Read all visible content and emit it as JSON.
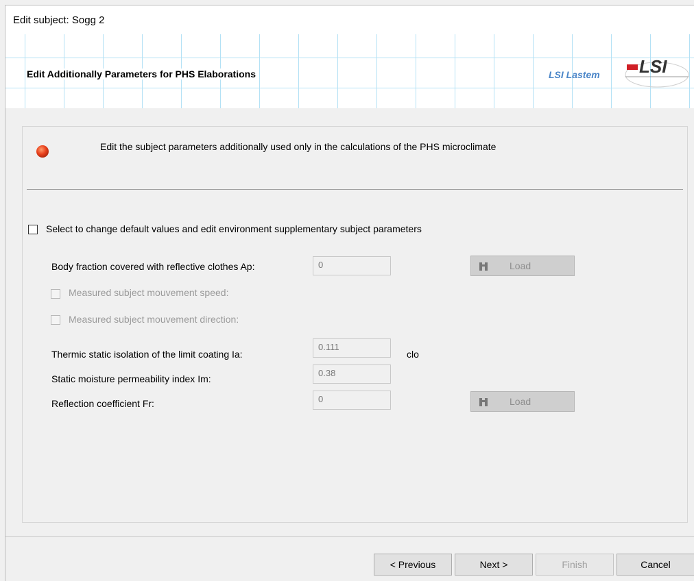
{
  "window": {
    "title": "Edit subject: Sogg 2"
  },
  "header": {
    "title": "Edit Additionally Parameters for PHS Elaborations",
    "brand_text": "LSI Lastem",
    "logo_text": "LSI"
  },
  "info": {
    "text": "Edit the subject parameters  additionally used only in the calculations of the PHS microclimate"
  },
  "form": {
    "enable_label": "Select to change default values and edit environment supplementary subject parameters",
    "ap_label": "Body fraction covered with reflective clothes Ap:",
    "ap_value": "0",
    "load_label": "Load",
    "speed_label": "Measured subject mouvement speed:",
    "direction_label": "Measured subject mouvement direction:",
    "ia_label": "Thermic static isolation of the limit coating Ia:",
    "ia_value": "0.111",
    "ia_unit": "clo",
    "im_label": "Static moisture permeability index Im:",
    "im_value": "0.38",
    "fr_label": "Reflection coefficient Fr:",
    "fr_value": "0"
  },
  "footer": {
    "previous": "< Previous",
    "next": "Next >",
    "finish": "Finish",
    "cancel": "Cancel"
  }
}
